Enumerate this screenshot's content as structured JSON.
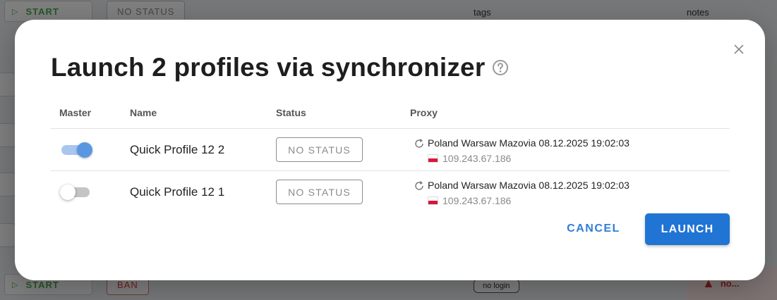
{
  "background": {
    "start_label": "START",
    "no_status_label": "NO STATUS",
    "tags_header": "tags",
    "notes_header": "notes",
    "ban_label": "BAN",
    "no_login_label": "no login",
    "warning_label": "no..."
  },
  "dialog": {
    "title": "Launch 2 profiles via synchronizer",
    "columns": {
      "master": "Master",
      "name": "Name",
      "status": "Status",
      "proxy": "Proxy"
    },
    "rows": [
      {
        "master": true,
        "name": "Quick Profile 12 2",
        "status": "NO STATUS",
        "proxy_label": "Poland Warsaw Mazovia 08.12.2025 19:02:03",
        "proxy_ip": "109.243.67.186"
      },
      {
        "master": false,
        "name": "Quick Profile 12 1",
        "status": "NO STATUS",
        "proxy_label": "Poland Warsaw Mazovia 08.12.2025 19:02:03",
        "proxy_ip": "109.243.67.186"
      }
    ],
    "cancel_label": "CANCEL",
    "launch_label": "LAUNCH"
  },
  "colors": {
    "accent": "#2074d4",
    "toggle_on": "#5a97e2",
    "status_text": "#8a8a8a"
  }
}
